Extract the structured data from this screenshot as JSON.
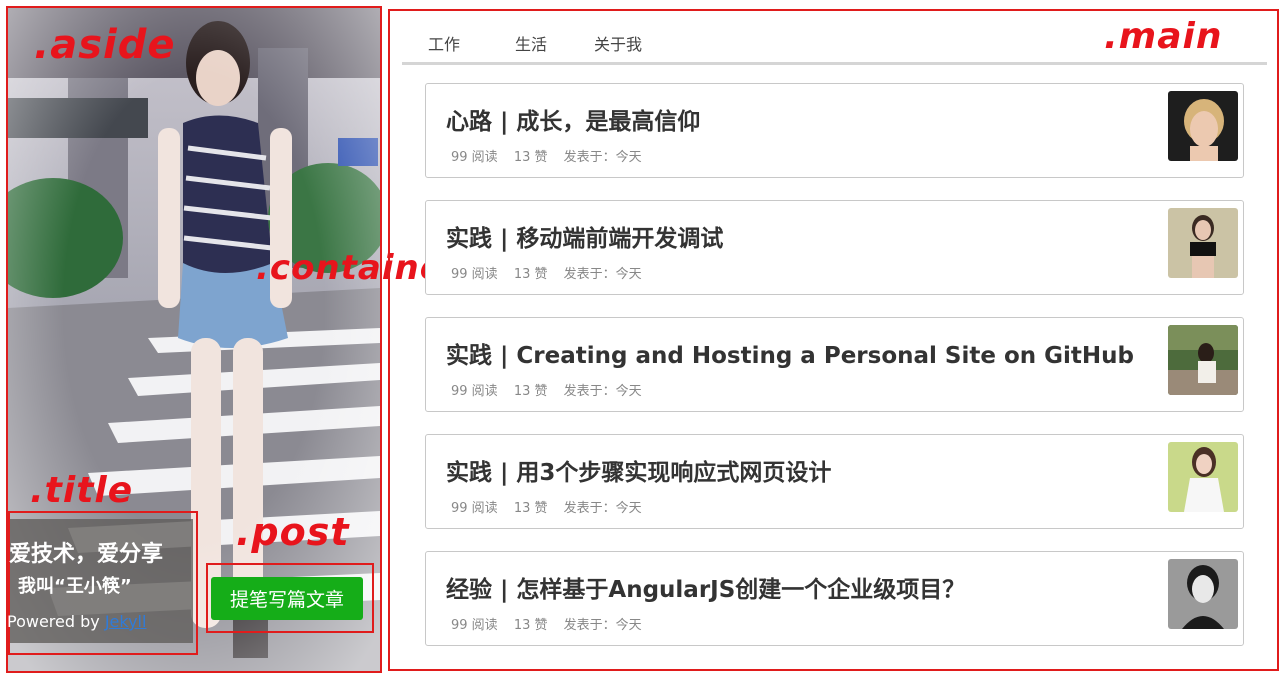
{
  "annotations": {
    "aside": ".aside",
    "container": ".container",
    "title": ".title",
    "post": ".post",
    "main": ".main"
  },
  "aside": {
    "title_line1": "爱技术，爱分享",
    "title_line2": "我叫“王小筷”",
    "powered_prefix": "Powered by",
    "powered_link": "Jekyll",
    "post_button": "提笔写篇文章"
  },
  "nav": {
    "items": [
      "工作",
      "生活",
      "关于我"
    ]
  },
  "posts": [
    {
      "title": "心路 | 成长，是最高信仰",
      "reads": "99 阅读",
      "likes": "13 赞",
      "date": "发表于：今天",
      "thumb": "portrait-short-blonde"
    },
    {
      "title": "实践 | 移动端前端开发调试",
      "reads": "99 阅读",
      "likes": "13 赞",
      "date": "发表于：今天",
      "thumb": "portrait-black-top"
    },
    {
      "title": "实践 | Creating and Hosting a Personal Site on GitHub",
      "reads": "99 阅读",
      "likes": "13 赞",
      "date": "发表于：今天",
      "thumb": "portrait-outdoor"
    },
    {
      "title": "实践 | 用3个步骤实现响应式网页设计",
      "reads": "99 阅读",
      "likes": "13 赞",
      "date": "发表于：今天",
      "thumb": "portrait-white-dress"
    },
    {
      "title": "经验 | 怎样基于AngularJS创建一个企业级项目？",
      "reads": "99 阅读",
      "likes": "13 赞",
      "date": "发表于：今天",
      "thumb": "portrait-black-white"
    }
  ],
  "colors": {
    "annotation": "#e8141c",
    "post_button": "#15ad18",
    "link": "#2f7bd9"
  }
}
